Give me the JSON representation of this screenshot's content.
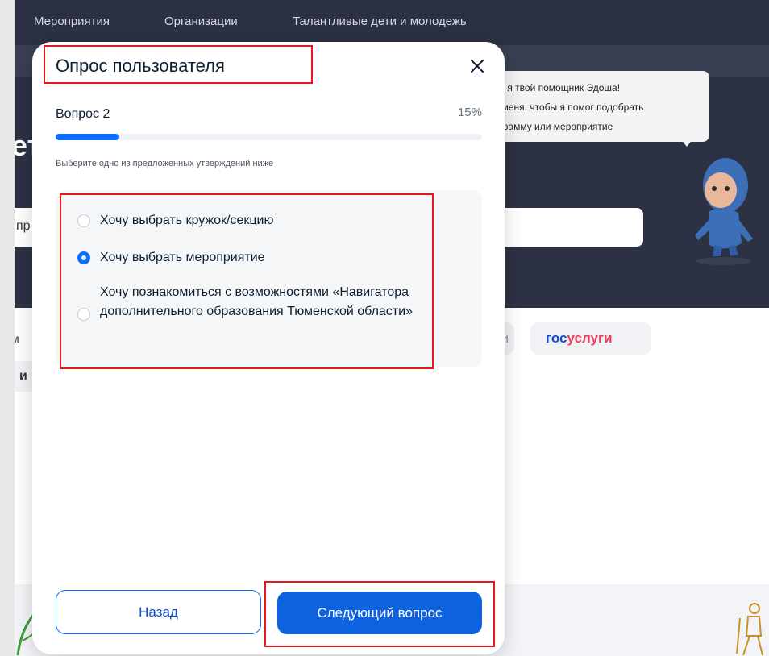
{
  "background_page": {
    "nav": [
      "Мероприятия",
      "Организации",
      "Талантливые дети и молодежь"
    ],
    "hero_partial_text": "ет",
    "search_partial_text": "пр",
    "assistant_bubble_lines": [
      "вет, я твой помощник Эдоша!",
      "на меня, чтобы я помог подобрать",
      "рограмму или мероприятие"
    ],
    "partner_left_text": "м",
    "partner_mid_text": "и",
    "partner_i_text": "и",
    "gosuslugi_a": "гос",
    "gosuslugi_b": "услуги"
  },
  "modal": {
    "title": "Опрос пользователя",
    "close_icon": "close-icon",
    "question_label": "Вопрос 2",
    "progress_percent_text": "15%",
    "progress_value": 0.15,
    "instruction": "Выберите одно из предложенных утверждений ниже",
    "options": [
      {
        "label": "Хочу выбрать кружок/секцию",
        "checked": false
      },
      {
        "label": "Хочу выбрать мероприятие",
        "checked": true
      },
      {
        "label": "Хочу познакомиться с возможностями «Навигатора дополнительного образования Тюменской области»",
        "checked": false
      }
    ],
    "back_label": "Назад",
    "next_label": "Следующий вопрос"
  },
  "colors": {
    "accent": "#0d6efd",
    "dark_header": "#2c3143",
    "annotation_red": "#e8151b"
  }
}
